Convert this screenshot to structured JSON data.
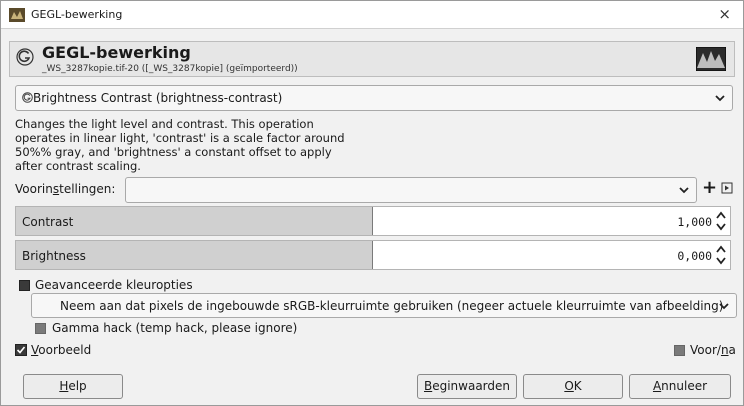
{
  "window": {
    "title": "GEGL-bewerking",
    "close_symbol": "×"
  },
  "header": {
    "title": "GEGL-bewerking",
    "subtitle": "_WS_3287kopie.tif-20 ([_WS_3287kopie] (geïmporteerd))"
  },
  "operation": {
    "selected": "Brightness Contrast (brightness-contrast)",
    "description": "Changes the light level and contrast. This operation operates in linear light, 'contrast' is a scale factor around 50%% gray, and 'brightness' a constant offset to apply after contrast scaling."
  },
  "presets": {
    "label_before": "Voorin",
    "label_mnemonic": "s",
    "label_after": "tellingen:",
    "value": "",
    "add_symbol": "+"
  },
  "sliders": [
    {
      "label": "Contrast",
      "value": "1,000",
      "fill_fraction": 0.5
    },
    {
      "label": "Brightness",
      "value": "0,000",
      "fill_fraction": 0.5
    }
  ],
  "advanced": {
    "label": "Geavanceerde kleuropties",
    "color_mode": "Neem aan dat pixels de ingebouwde sRGB-kleurruimte gebruiken (negeer actuele kleurruimte van afbeelding)",
    "gamma_hack": "Gamma hack (temp hack, please ignore)"
  },
  "preview": {
    "mnemonic": "V",
    "rest": "oorbeeld",
    "split_before": "Voor/",
    "split_mnemonic": "n",
    "split_after": "a"
  },
  "buttons": {
    "help_mn": "H",
    "help_rest": "elp",
    "reset_mn": "B",
    "reset_rest": "eginwaarden",
    "ok_mn": "O",
    "ok_rest": "K",
    "cancel_mn": "A",
    "cancel_rest": "nnuleer"
  },
  "colors": {
    "dialog_bg": "#f1f1f1",
    "slider_fill": "#d0d0d0",
    "checkbox_fill": "#7a7a7a"
  }
}
